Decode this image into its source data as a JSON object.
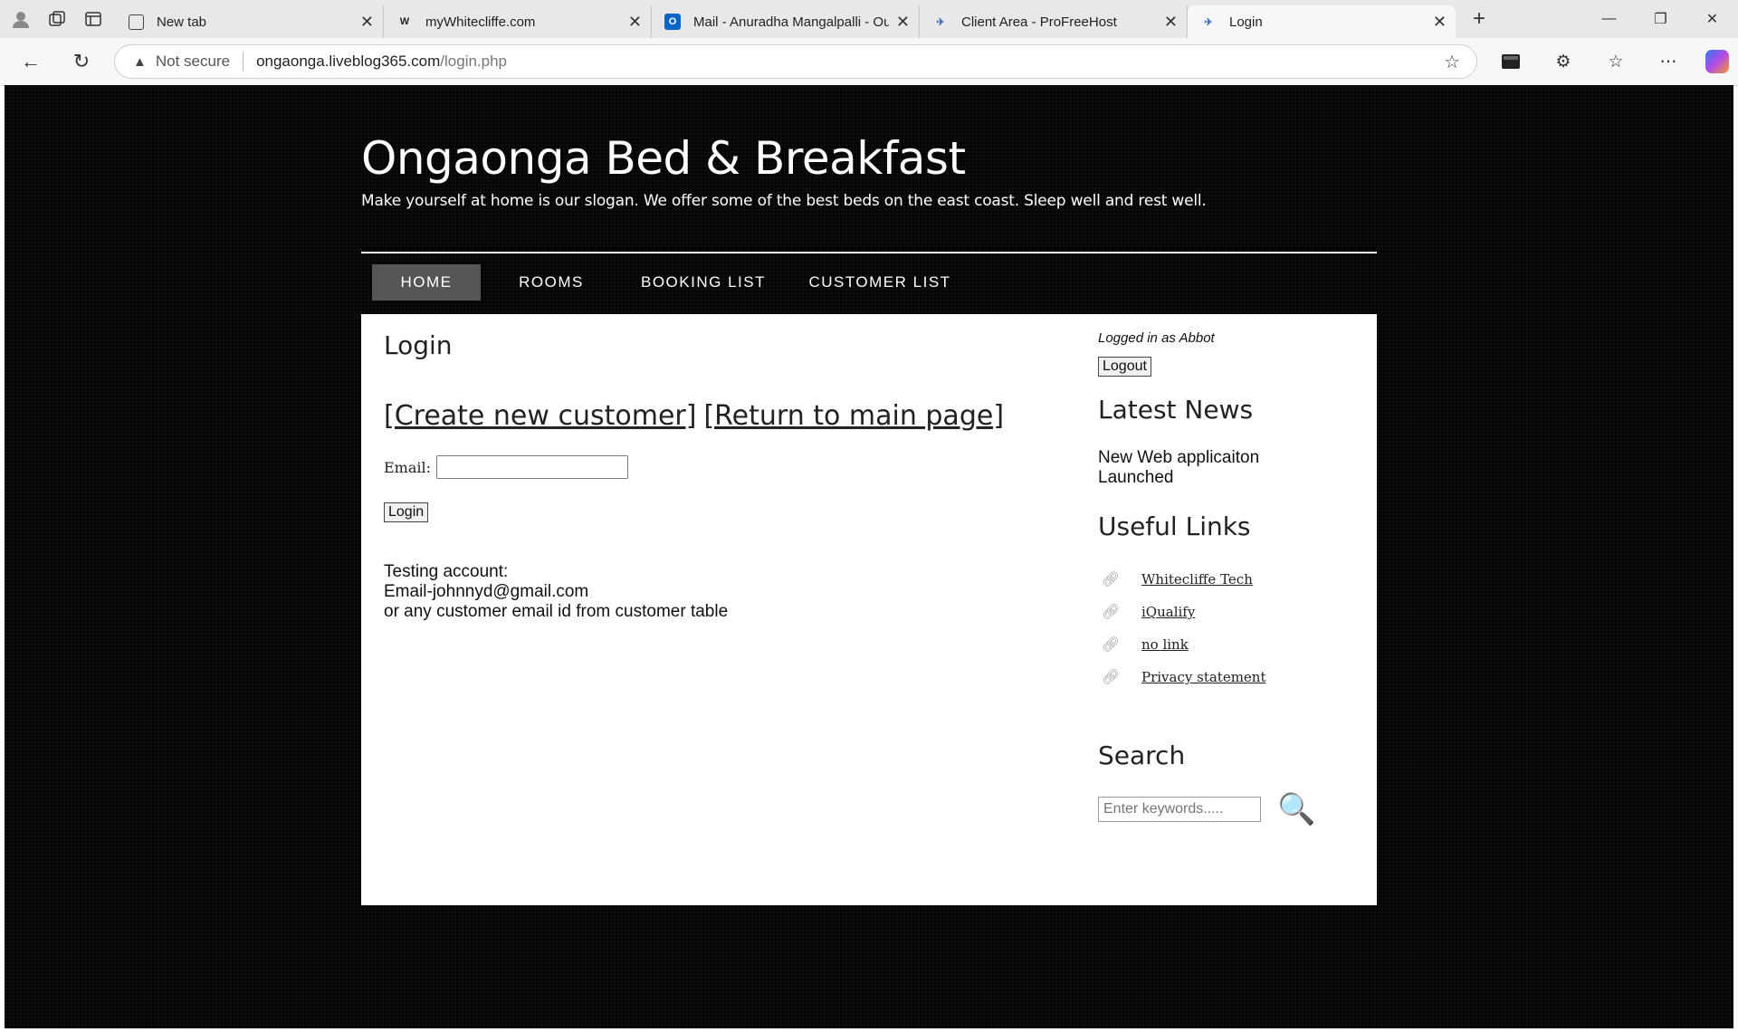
{
  "browser": {
    "tabs": [
      {
        "title": "New tab",
        "favicon": "new-tab-icon",
        "active": false
      },
      {
        "title": "myWhitecliffe.com",
        "favicon": "whitecliffe-icon",
        "active": false
      },
      {
        "title": "Mail - Anuradha Mangalpalli - Ou",
        "favicon": "outlook-icon",
        "active": false
      },
      {
        "title": "Client Area - ProFreeHost",
        "favicon": "profreehost-icon",
        "active": false
      },
      {
        "title": "Login",
        "favicon": "profreehost-icon",
        "active": true
      }
    ],
    "security_label": "Not secure",
    "url_host": "ongaonga.liveblog365.com",
    "url_path": "/login.php"
  },
  "site": {
    "title": "Ongaonga Bed & Breakfast",
    "slogan": "Make yourself at home is our slogan. We offer some of the best beds on the east coast. Sleep well and rest well.",
    "menu": [
      {
        "label": "HOME",
        "selected": true
      },
      {
        "label": "ROOMS",
        "selected": false
      },
      {
        "label": "BOOKING LIST",
        "selected": false
      },
      {
        "label": "CUSTOMER LIST",
        "selected": false
      }
    ]
  },
  "main": {
    "heading": "Login",
    "link_create": "[Create new customer]",
    "link_return": "[Return to main page]",
    "email_label": "Email:",
    "email_value": "",
    "login_button": "Login",
    "note_line1": "Testing account:",
    "note_line2": "Email-johnnyd@gmail.com",
    "note_line3": "or any customer email id from customer table"
  },
  "sidebar": {
    "logged_in": "Logged in as Abbot",
    "logout_button": "Logout",
    "news_heading": "Latest News",
    "news_item": "New Web applicaiton Launched",
    "links_heading": "Useful Links",
    "links": [
      "Whitecliffe Tech",
      "iQualify",
      "no link",
      "Privacy statement"
    ],
    "search_heading": "Search",
    "search_placeholder": "Enter keywords....."
  },
  "colors": {
    "page_background": "#050505",
    "menu_selected": "#555555",
    "content_background": "#ffffff"
  }
}
